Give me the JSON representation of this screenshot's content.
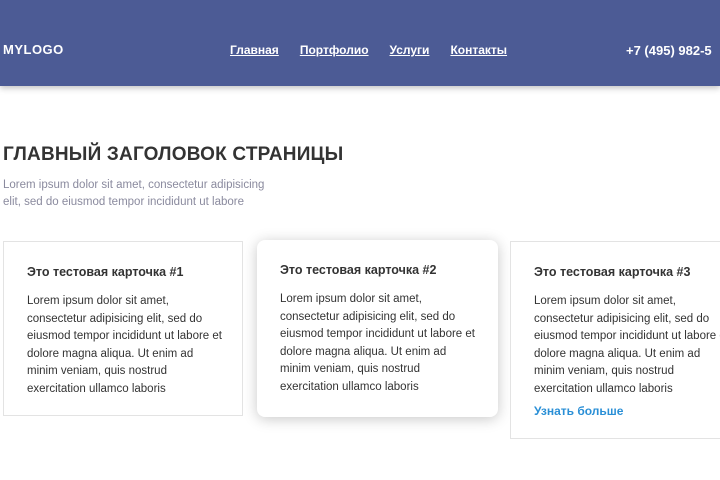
{
  "header": {
    "logo": "MYLOGO",
    "nav": [
      "Главная",
      "Портфолио",
      "Услуги",
      "Контакты"
    ],
    "phone": "+7 (495) 982-5"
  },
  "main": {
    "title": "ГЛАВНЫЙ ЗАГОЛОВОК СТРАНИЦЫ",
    "lead": "Lorem ipsum dolor sit amet, consectetur adipisicing elit, sed do eiusmod tempor incididunt ut labore"
  },
  "cards": [
    {
      "title": "Это тестовая карточка #1",
      "text": "Lorem ipsum dolor sit amet, consectetur adipisicing elit, sed do eiusmod tempor incididunt ut labore et dolore magna aliqua. Ut enim ad minim veniam, quis nostrud exercitation ullamco laboris"
    },
    {
      "title": "Это тестовая карточка #2",
      "text": "Lorem ipsum dolor sit amet, consectetur adipisicing elit, sed do eiusmod tempor incididunt ut labore et dolore magna aliqua. Ut enim ad minim veniam, quis nostrud exercitation ullamco laboris"
    },
    {
      "title": "Это тестовая карточка #3",
      "text": "Lorem ipsum dolor sit amet, consectetur adipisicing elit, sed do eiusmod tempor incididunt ut labore et dolore magna aliqua. Ut enim ad minim veniam, quis nostrud exercitation ullamco laboris",
      "link": "Узнать больше"
    }
  ],
  "colors": {
    "header_bg": "#4c5b95",
    "link": "#2a8fd6",
    "text": "#333333",
    "muted": "#8a8a9e"
  }
}
